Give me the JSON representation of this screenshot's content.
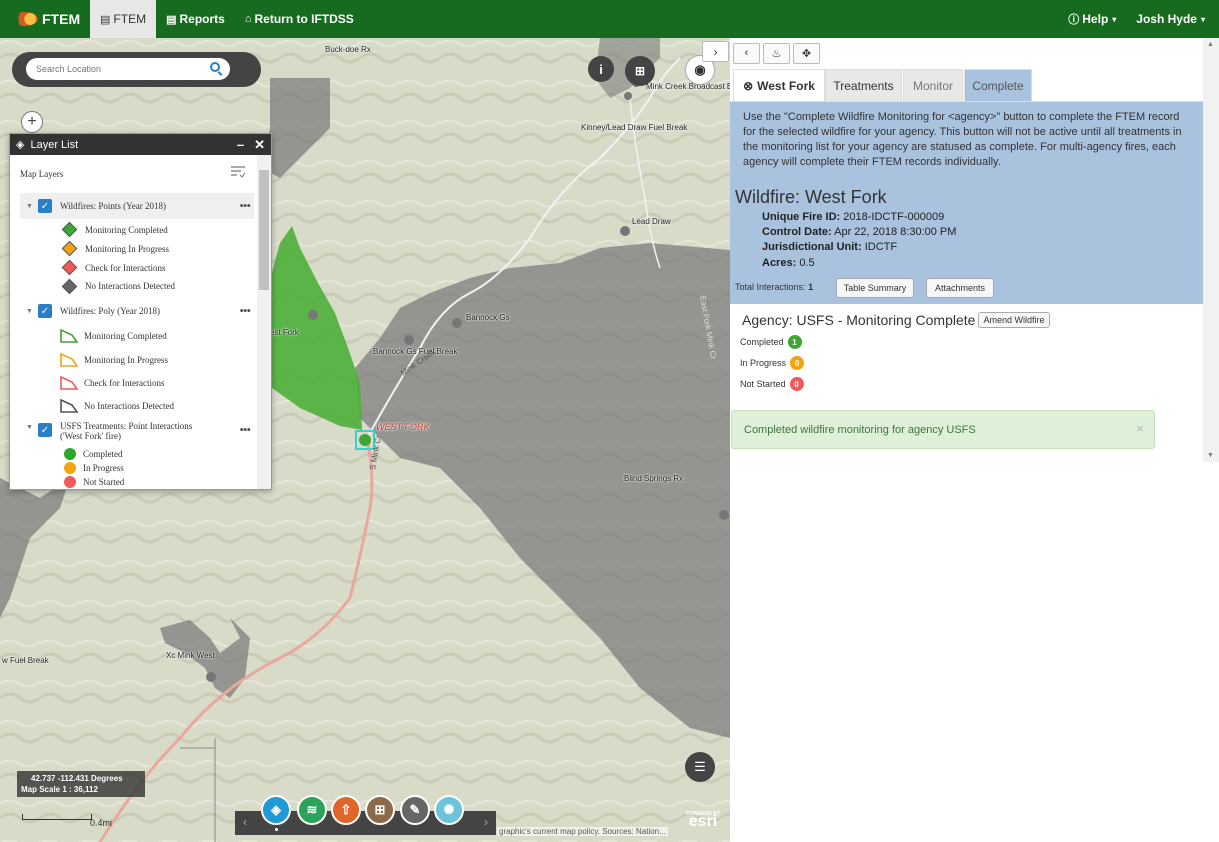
{
  "nav": {
    "brand": "FTEM",
    "items": [
      {
        "label": "FTEM",
        "icon": "ftem-doc-icon"
      },
      {
        "label": "Reports",
        "icon": "report-icon"
      },
      {
        "label": "Return to IFTDSS",
        "icon": "home-icon"
      }
    ],
    "help": "Help",
    "user": "Josh Hyde"
  },
  "map": {
    "search_placeholder": "Search Location",
    "labels": {
      "buckdoe": "Buck-doe Rx",
      "mink_creek_broadcast": "Mink Creek Broadcast Bu",
      "kinney_lead_draw": "Kinney/Lead Draw Fuel Break",
      "lead_draw": "Lead Draw",
      "bannock_gs": "Bannock Gs",
      "bannock_gs_fuel_break": "Bannock Gs Fuel Break",
      "west_fork_partial": "est Fork",
      "west_fork": "WEST FORK",
      "blind_springs": "Blind Springs Rx",
      "xc_mink_west": "Xc Mink West",
      "fuel_break_partial": "w Fuel Break",
      "mink_creek_rd": "Mink Creek",
      "s_mink_creek": "S Mink Cr",
      "east_fork": "East Fork Mink Cr"
    },
    "coords": "42.737 -112.431 Degrees",
    "scale": "Map Scale 1 : 36,112",
    "scalebar_label": "0.4mi",
    "attribution": "graphic's current map policy. Sources: Nation...",
    "esri_powered": "POWERED BY",
    "esri": "esri"
  },
  "layer_list": {
    "title": "Layer List",
    "minimize": "–",
    "close": "✕",
    "map_layers": "Map Layers",
    "groups": [
      {
        "name": "Wildfires: Points (Year 2018)",
        "items": [
          {
            "label": "Monitoring Completed",
            "color": "#3fa535"
          },
          {
            "label": "Monitoring In Progress",
            "color": "#f0a50f"
          },
          {
            "label": "Check for Interactions",
            "color": "#f05a5a"
          },
          {
            "label": "No Interactions Detected",
            "color": "#666666"
          }
        ]
      },
      {
        "name": "Wildfires: Poly (Year 2018)",
        "items": [
          {
            "label": "Monitoring Completed",
            "color": "#3fa535"
          },
          {
            "label": "Monitoring In Progress",
            "color": "#f0a50f"
          },
          {
            "label": "Check for Interactions",
            "color": "#f05a5a"
          },
          {
            "label": "No Interactions Detected",
            "color": "#555555"
          }
        ]
      },
      {
        "name": "USFS Treatments: Point Interactions ('West Fork' fire)",
        "items": [
          {
            "label": "Completed",
            "color": "#2fa52d"
          },
          {
            "label": "In Progress",
            "color": "#f0a50f"
          },
          {
            "label": "Not Started",
            "color": "#f05a5a"
          }
        ]
      }
    ]
  },
  "panel": {
    "tabs": [
      "West Fork",
      "Treatments",
      "Monitor",
      "Complete"
    ],
    "info_text": "Use the \"Complete Wildfire Monitoring for <agency>\" button to complete the FTEM record for the selected wildfire for your agency. This button will not be active until all treatments in the monitoring list for your agency are statused as complete. For multi-agency fires, each agency will complete their FTEM records individually.",
    "wildfire_title": "Wildfire: West Fork",
    "fields": [
      {
        "label": "Unique Fire ID:",
        "value": "2018-IDCTF-000009"
      },
      {
        "label": "Control Date:",
        "value": "Apr 22, 2018 8:30:00 PM"
      },
      {
        "label": "Jurisdictional Unit:",
        "value": "IDCTF"
      },
      {
        "label": "Acres:",
        "value": "0.5"
      }
    ],
    "total_interactions_label": "Total Interactions:",
    "total_interactions_value": "1",
    "table_summary": "Table Summary",
    "attachments": "Attachments",
    "agency_title": "Agency: USFS - Monitoring Complete",
    "amend_wildfire": "Amend Wildfire",
    "statuses": [
      {
        "label": "Completed",
        "count": "1",
        "color": "#3fa535"
      },
      {
        "label": "In Progress",
        "count": "0",
        "color": "#f0a50f"
      },
      {
        "label": "Not Started",
        "count": "0",
        "color": "#f05a5a"
      }
    ],
    "alert": "Completed wildfire monitoring for agency USFS",
    "alert_close": "×"
  },
  "colors": {
    "nav_green": "#176b1e",
    "panel_blue": "#a9c2de",
    "tab_complete": "#a9c2de",
    "alert_green": "#dff0d8"
  }
}
